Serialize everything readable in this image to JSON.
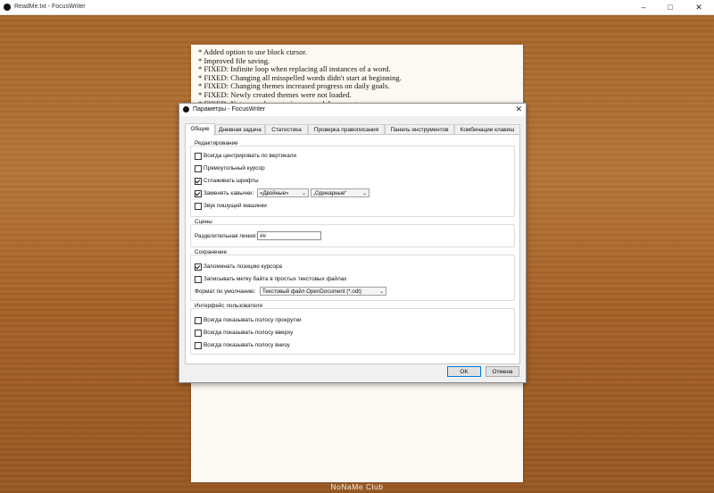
{
  "window": {
    "title": "ReadMe.txt - FocusWriter",
    "minimize_icon": "minimize-icon",
    "maximize_icon": "maximize-icon",
    "close_icon": "close-icon"
  },
  "document": {
    "lines": [
      "* Added option to use block cursor.",
      "* Improved file saving.",
      "* FIXED: Infinite loop when replacing all instances of a word.",
      "* FIXED: Changing all misspelled words didn't start at beginning.",
      "* FIXED: Changing themes increased progress on daily goals.",
      "* FIXED: Newly created themes were not loaded.",
      "* FIXED: Not properly centering opened documents."
    ]
  },
  "footer": {
    "brand": "NoNaMe Club"
  },
  "dialog": {
    "title": "Параметры - FocusWriter",
    "tabs": [
      "Общие",
      "Дневная задача",
      "Статистика",
      "Проверка правописания",
      "Панель инструментов",
      "Комбинации клавиш"
    ],
    "active_tab": "Общие",
    "editing": {
      "title": "Редактирование",
      "always_center": "Всегда центрировать по вертикали",
      "block_cursor": "Прямоугольный курсор",
      "smooth_fonts": "Сглаживать шрифты",
      "replace_quotes": "Заменять кавычки:",
      "double_quotes": "«Двойные»",
      "single_quotes": "„Одинарные“",
      "typewriter_sound": "Звук пишущей машинки"
    },
    "scenes": {
      "title": "Сцены",
      "divider_label": "Разделительная линия:",
      "divider_value": "##"
    },
    "saving": {
      "title": "Сохранение",
      "remember_cursor": "Запоминать позицию курсора",
      "write_bom": "Записывать метку байта в простых текстовых файлах",
      "default_format_label": "Формат по умолчанию:",
      "default_format_value": "Текстовый файл OpenDocument (*.odt)"
    },
    "ui": {
      "title": "Интерфейс пользователя",
      "always_scrollbar": "Всегда показывать полосу прокрутки",
      "always_top_bar": "Всегда показывать полосу вверху",
      "always_bottom_bar": "Всегда показывать полосу внизу"
    },
    "ok": "OK",
    "cancel": "Отмена"
  },
  "colors": {
    "accent": "#0078d7",
    "wood": "#a9672a"
  }
}
